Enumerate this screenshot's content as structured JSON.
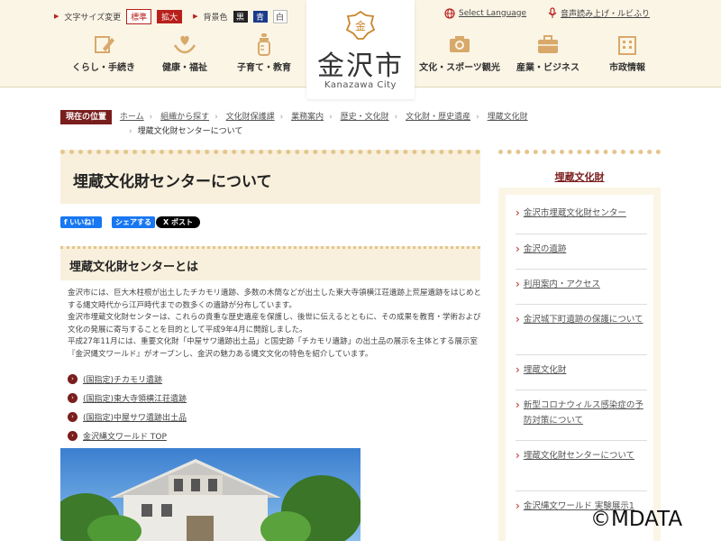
{
  "header": {
    "font_size_label": "文字サイズ変更",
    "font_std": "標準",
    "font_big": "拡大",
    "bg_label": "背景色",
    "bg_black": "黒",
    "bg_blue": "青",
    "bg_white": "白",
    "language": "Select Language",
    "voice": "音声読み上げ・ルビふり",
    "logo_kanji": "金沢市",
    "logo_roman": "Kanazawa City",
    "nav": [
      {
        "label": "くらし・手続き",
        "icon": "pencil-icon"
      },
      {
        "label": "健康・福祉",
        "icon": "heart-hands-icon"
      },
      {
        "label": "子育て・教育",
        "icon": "bottle-icon"
      },
      {
        "label": "文化・スポーツ観光",
        "icon": "camera-icon"
      },
      {
        "label": "産業・ビジネス",
        "icon": "briefcase-icon"
      },
      {
        "label": "市政情報",
        "icon": "building-icon"
      }
    ]
  },
  "breadcrumb": {
    "here": "現在の位置",
    "items": [
      "ホーム",
      "組織から探す",
      "文化財保護課",
      "業務案内",
      "歴史・文化財",
      "文化財・歴史遺産",
      "埋蔵文化財"
    ],
    "current": "埋蔵文化財センターについて"
  },
  "main": {
    "title": "埋蔵文化財センターについて",
    "sns": {
      "like": "いいね！",
      "share": "シェアする",
      "post": "X ポスト"
    },
    "subtitle": "埋蔵文化財センターとは",
    "paragraphs": [
      "金沢市には、巨大木柱根が出土したチカモリ遺跡、多数の木簡などが出土した東大寺領横江荘遺跡上荒屋遺跡をはじめとする縄文時代から江戸時代までの数多くの遺跡が分布しています。",
      "金沢市埋蔵文化財センターは、これらの貴重な歴史遺産を保護し、後世に伝えるとともに、その成果を教育・学術および文化の発展に寄与することを目的として平成9年4月に開館しました。",
      "平成27年11月には、重要文化財「中屋サワ遺跡出土品」と国史跡「チカモリ遺跡」の出土品の展示を主体とする展示室『金沢縄文ワールド』がオープンし、金沢の魅力ある縄文文化の特色を紹介しています。"
    ],
    "links": [
      "(国指定)チカモリ遺跡",
      "(国指定)東大寺領横江荘遺跡",
      "(国指定)中屋サワ遺跡出土品",
      "金沢縄文ワールド TOP"
    ]
  },
  "sidebar": {
    "title": "埋蔵文化財",
    "items": [
      "金沢市埋蔵文化財センター",
      "金沢の遺跡",
      "利用案内・アクセス",
      "金沢城下町遺跡の保護について",
      "埋蔵文化財",
      "新型コロナウィルス感染症の予防対策について",
      "埋蔵文化財センターについて",
      "金沢縄文ワールド 実験展示1"
    ]
  },
  "watermark": "©MDATA",
  "colors": {
    "accent": "#b8201c",
    "dark_red": "#7a1d1d",
    "cream": "#fbf5e6",
    "box": "#f8f0dc"
  }
}
